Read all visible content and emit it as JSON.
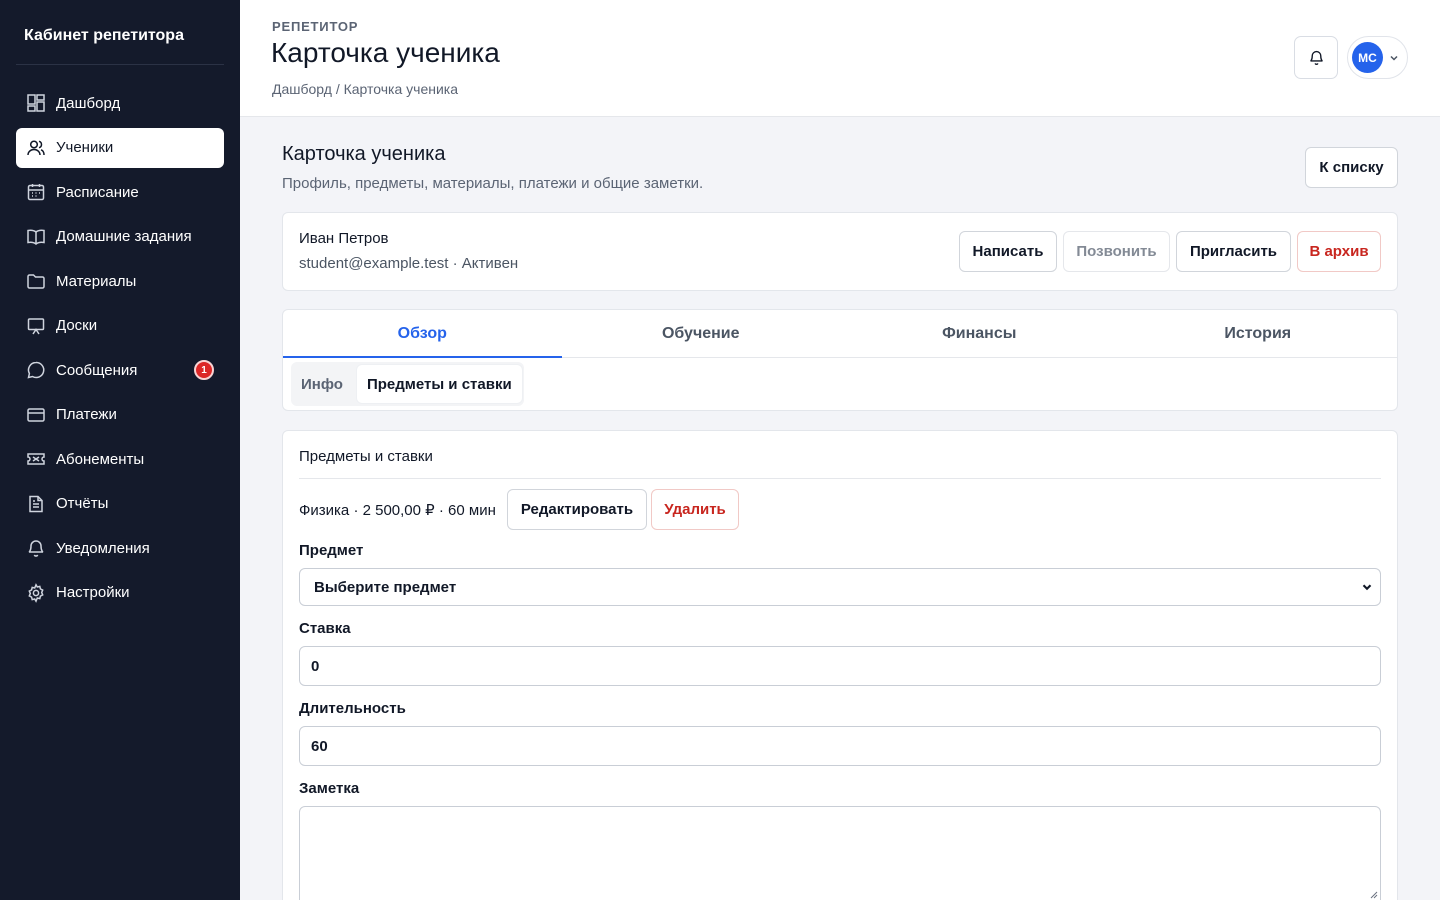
{
  "sidebar": {
    "brand": "Кабинет репетитора",
    "items": [
      {
        "label": "Дашборд",
        "icon": "dashboard-icon"
      },
      {
        "label": "Ученики",
        "icon": "users-icon",
        "active": true
      },
      {
        "label": "Расписание",
        "icon": "calendar-icon"
      },
      {
        "label": "Домашние задания",
        "icon": "book-icon"
      },
      {
        "label": "Материалы",
        "icon": "folder-icon"
      },
      {
        "label": "Доски",
        "icon": "board-icon"
      },
      {
        "label": "Сообщения",
        "icon": "message-icon",
        "badge": "1"
      },
      {
        "label": "Платежи",
        "icon": "credit-card-icon"
      },
      {
        "label": "Абонементы",
        "icon": "ticket-icon"
      },
      {
        "label": "Отчёты",
        "icon": "report-icon"
      },
      {
        "label": "Уведомления",
        "icon": "bell-icon"
      },
      {
        "label": "Настройки",
        "icon": "gear-icon"
      }
    ]
  },
  "header": {
    "eyebrow": "РЕПЕТИТОР",
    "title": "Карточка ученика",
    "breadcrumb": "Дашборд / Карточка ученика",
    "avatar_initials": "МС"
  },
  "main": {
    "title": "Карточка ученика",
    "subtitle": "Профиль, предметы, материалы, платежи и общие заметки.",
    "back_label": "К списку",
    "student": {
      "name": "Иван Петров",
      "meta": "student@example.test · Активен",
      "actions": {
        "write": "Написать",
        "call": "Позвонить",
        "invite": "Пригласить",
        "archive": "В архив"
      }
    },
    "tabs": [
      "Обзор",
      "Обучение",
      "Финансы",
      "История"
    ],
    "subtabs": [
      "Инфо",
      "Предметы и ставки"
    ],
    "form": {
      "title": "Предметы и ставки",
      "rate_line": "Физика · 2 500,00 ₽ · 60 мин",
      "edit_label": "Редактировать",
      "delete_label": "Удалить",
      "subject_label": "Предмет",
      "subject_value": "Выберите предмет",
      "rate_label": "Ставка",
      "rate_value": "0",
      "duration_label": "Длительность",
      "duration_value": "60",
      "note_label": "Заметка",
      "note_value": ""
    }
  },
  "colors": {
    "sidebar_bg": "#141a2b",
    "accent": "#2563eb",
    "danger": "#c8261f"
  }
}
